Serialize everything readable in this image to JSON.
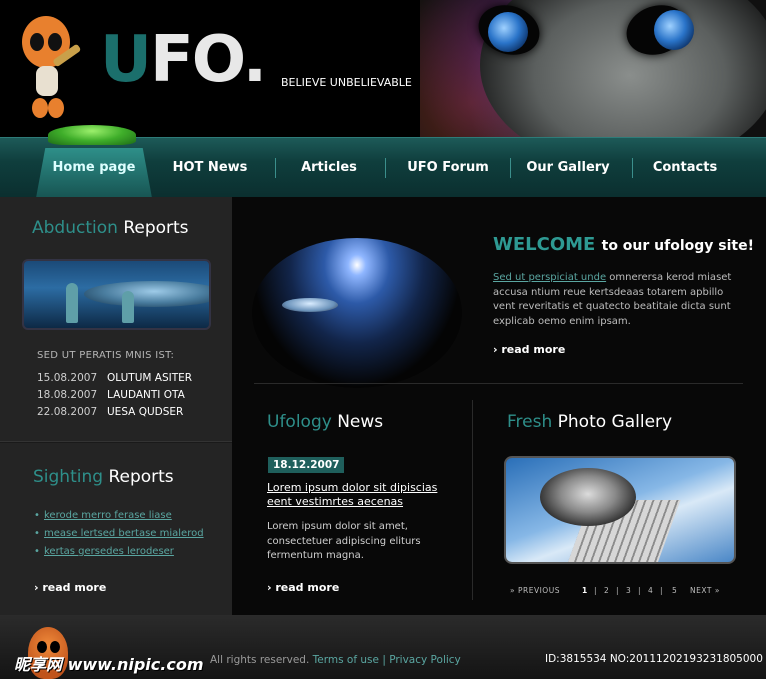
{
  "header": {
    "logo_u": "U",
    "logo_rest": "FO.",
    "tagline": "BELIEVE UNBELIEVABLE"
  },
  "nav": {
    "items": [
      {
        "label": "Home page",
        "active": true
      },
      {
        "label": "HOT News",
        "active": false
      },
      {
        "label": "Articles",
        "active": false
      },
      {
        "label": "UFO Forum",
        "active": false
      },
      {
        "label": "Our Gallery",
        "active": false
      },
      {
        "label": "Contacts",
        "active": false
      }
    ]
  },
  "abduction": {
    "title_hl": "Abduction",
    "title_rest": "Reports",
    "heading": "SED UT PERATIS MNIS IST:",
    "entries": [
      {
        "date": "15.08.2007",
        "text": "OLUTUM ASITER"
      },
      {
        "date": "18.08.2007",
        "text": "LAUDANTI OTA"
      },
      {
        "date": "22.08.2007",
        "text": "UESA QUDSER"
      }
    ]
  },
  "sighting": {
    "title_hl": "Sighting",
    "title_rest": "Reports",
    "links": [
      "kerode merro ferase liase",
      "mease lertsed bertase mialerod",
      "kertas gersedes lerodeser"
    ],
    "read_more": "read more"
  },
  "welcome": {
    "title": "WELCOME",
    "subtitle": "to our ufology site!",
    "link_text": "Sed ut perspiciat unde",
    "body": " omnerersa kerod miaset accusa ntium reue kertsdeaas totarem apbillo vent reveritatis et quatecto beatitaie dicta sunt explicab oemo enim ipsam.",
    "read_more": "read more"
  },
  "news": {
    "title_hl": "Ufology",
    "title_rest": "News",
    "date": "18.12.2007",
    "headline": "Lorem ipsum dolor sit dipiscias eent vestimrtes aecenas",
    "body": "Lorem ipsum dolor sit amet, consectetuer adipiscing eliturs fermentum  magna.",
    "read_more": "read more"
  },
  "gallery": {
    "title_hl": "Fresh",
    "title_rest": "Photo Gallery",
    "prev": "PREVIOUS",
    "next": "NEXT",
    "pages": [
      "1",
      "2",
      "3",
      "4",
      "5"
    ],
    "current_page": "1"
  },
  "footer": {
    "copyright": "All rights reserved.",
    "terms": "Terms of use",
    "sep": "|",
    "privacy": "Privacy Policy",
    "watermark": "昵享网 www.nipic.com",
    "id_text": "ID:3815534 NO:20111202193231805000"
  },
  "colors": {
    "accent": "#1b6f6c",
    "nav_bg": "#0f3e3d",
    "link": "#5aa6a1"
  }
}
